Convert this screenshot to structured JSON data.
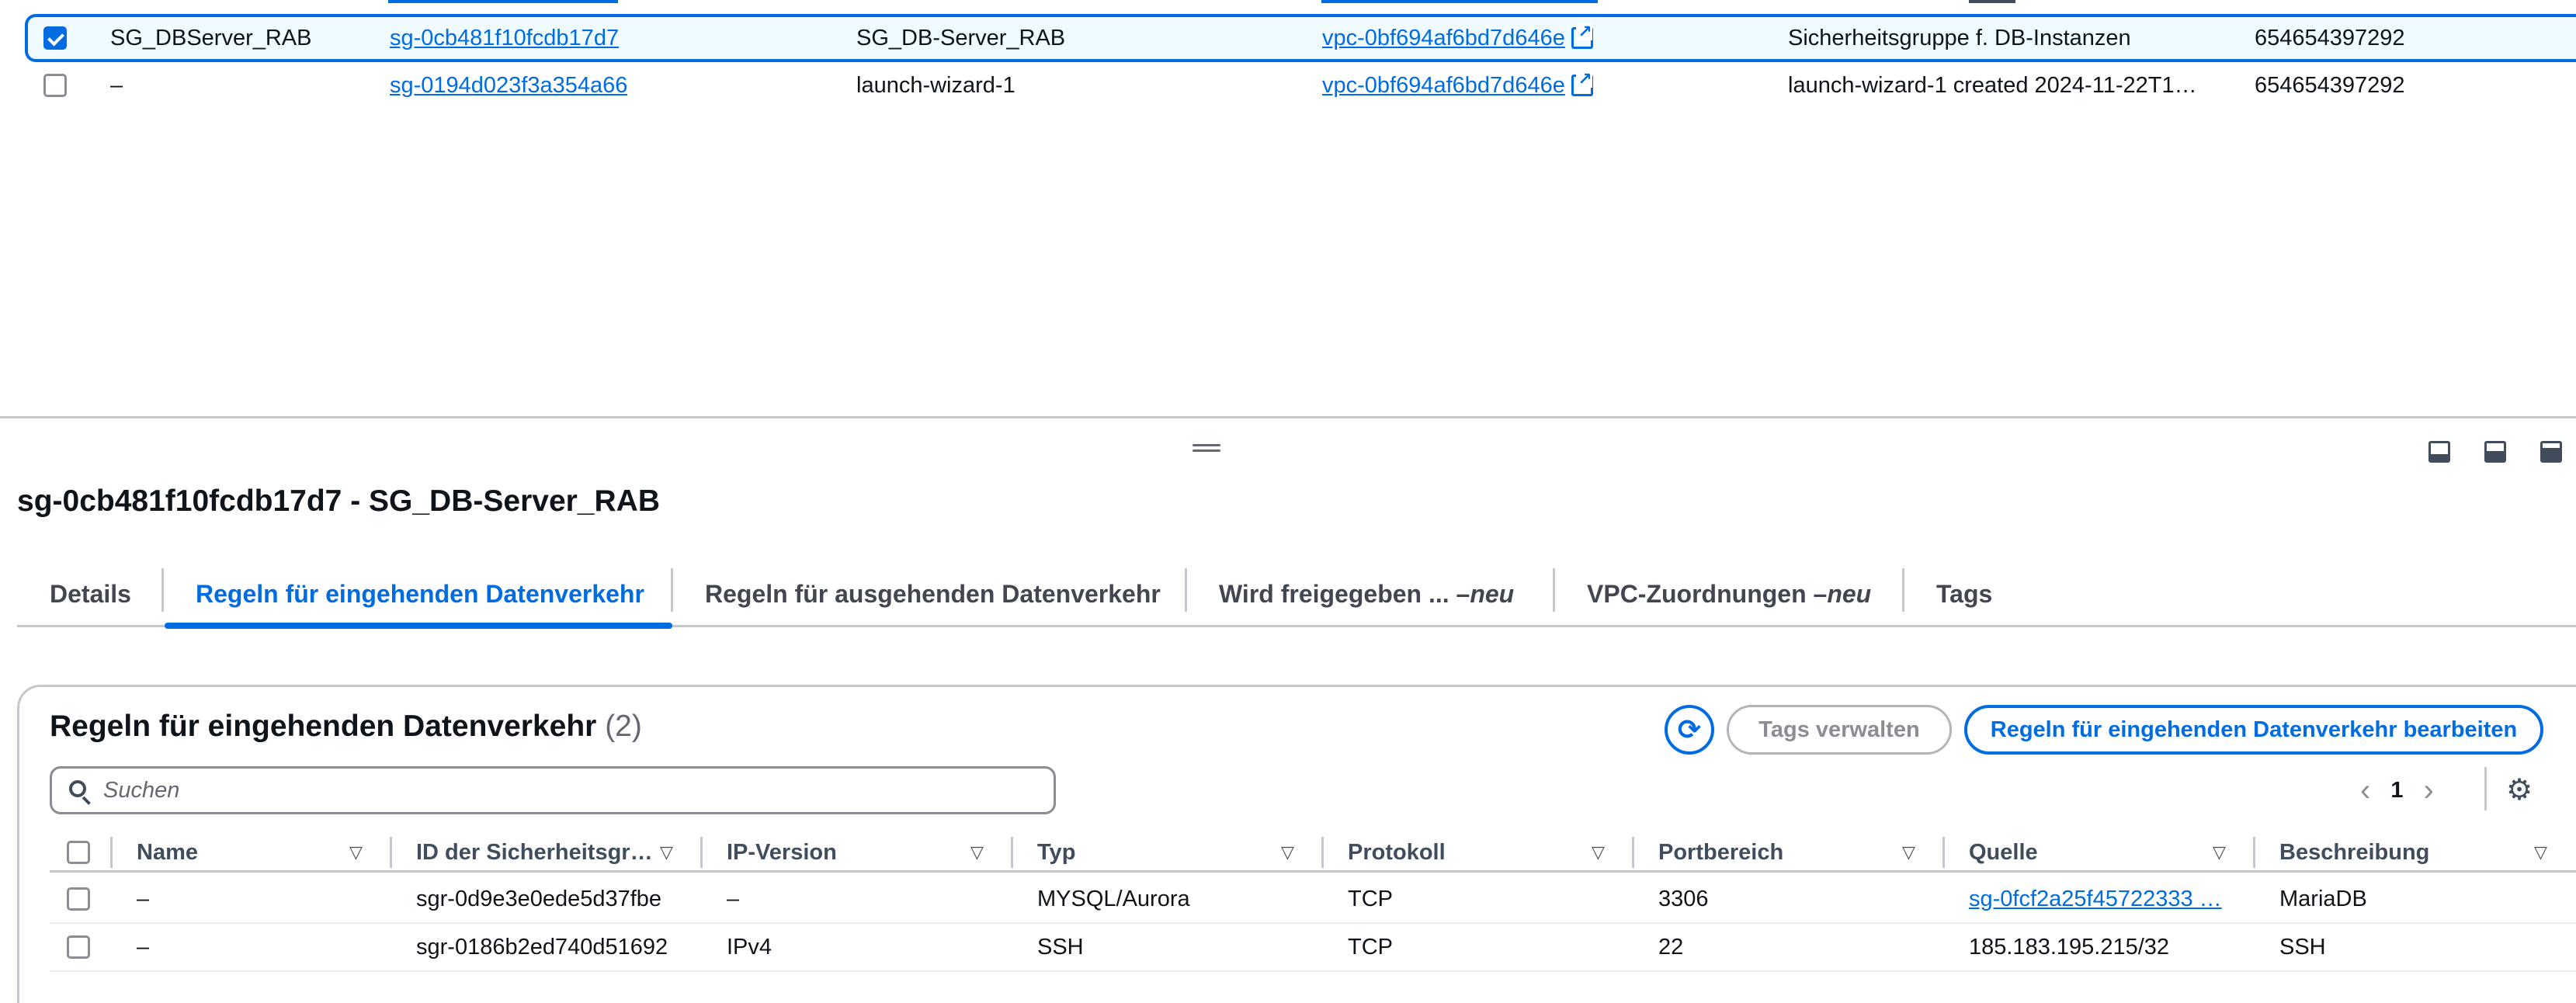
{
  "top_table": {
    "rows": [
      {
        "selected": true,
        "name": "SG_DBServer_RAB",
        "sg_id": "sg-0cb481f10fcdb17d7",
        "group_name": "SG_DB-Server_RAB",
        "vpc_id": "vpc-0bf694af6bd7d646e",
        "description": "Sicherheitsgruppe f. DB-Instanzen",
        "owner": "654654397292"
      },
      {
        "selected": false,
        "name": "–",
        "sg_id": "sg-0194d023f3a354a66",
        "group_name": "launch-wizard-1",
        "vpc_id": "vpc-0bf694af6bd7d646e",
        "description": "launch-wizard-1 created 2024-11-22T1…",
        "owner": "654654397292"
      }
    ]
  },
  "detail": {
    "title": "sg-0cb481f10fcdb17d7 - SG_DB-Server_RAB",
    "tabs": [
      {
        "label": "Details",
        "suffix": "",
        "active": false
      },
      {
        "label": "Regeln für eingehenden Datenverkehr",
        "suffix": "",
        "active": true
      },
      {
        "label": "Regeln für ausgehenden Datenverkehr",
        "suffix": "",
        "active": false
      },
      {
        "label": "Wird freigegeben ... – ",
        "suffix": "neu",
        "active": false
      },
      {
        "label": "VPC-Zuordnungen – ",
        "suffix": "neu",
        "active": false
      },
      {
        "label": "Tags",
        "suffix": "",
        "active": false
      }
    ]
  },
  "rules": {
    "title": "Regeln für eingehenden Datenverkehr",
    "count": "(2)",
    "manage_tags_label": "Tags verwalten",
    "edit_label": "Regeln für eingehenden Datenverkehr bearbeiten",
    "search_placeholder": "Suchen",
    "page": "1",
    "columns": [
      "Name",
      "ID der Sicherheitsgr…",
      "IP-Version",
      "Typ",
      "Protokoll",
      "Portbereich",
      "Quelle",
      "Beschreibung"
    ],
    "rows": [
      {
        "name": "–",
        "id": "sgr-0d9e3e0ede5d37fbe",
        "ip_version": "–",
        "type": "MYSQL/Aurora",
        "protocol": "TCP",
        "port": "3306",
        "source": "sg-0fcf2a25f45722333 …",
        "description": "MariaDB"
      },
      {
        "name": "–",
        "id": "sgr-0186b2ed740d51692",
        "ip_version": "IPv4",
        "type": "SSH",
        "protocol": "TCP",
        "port": "22",
        "source": "185.183.195.215/32",
        "description": "SSH"
      }
    ]
  },
  "icons": {
    "refresh": "refresh-icon",
    "search": "search-icon",
    "settings": "gear-icon",
    "external": "external-link-icon"
  },
  "colors": {
    "accent": "#006ce0",
    "selected_bg": "#f0fbff",
    "border": "#c6c6cd",
    "text": "#0f141a"
  }
}
